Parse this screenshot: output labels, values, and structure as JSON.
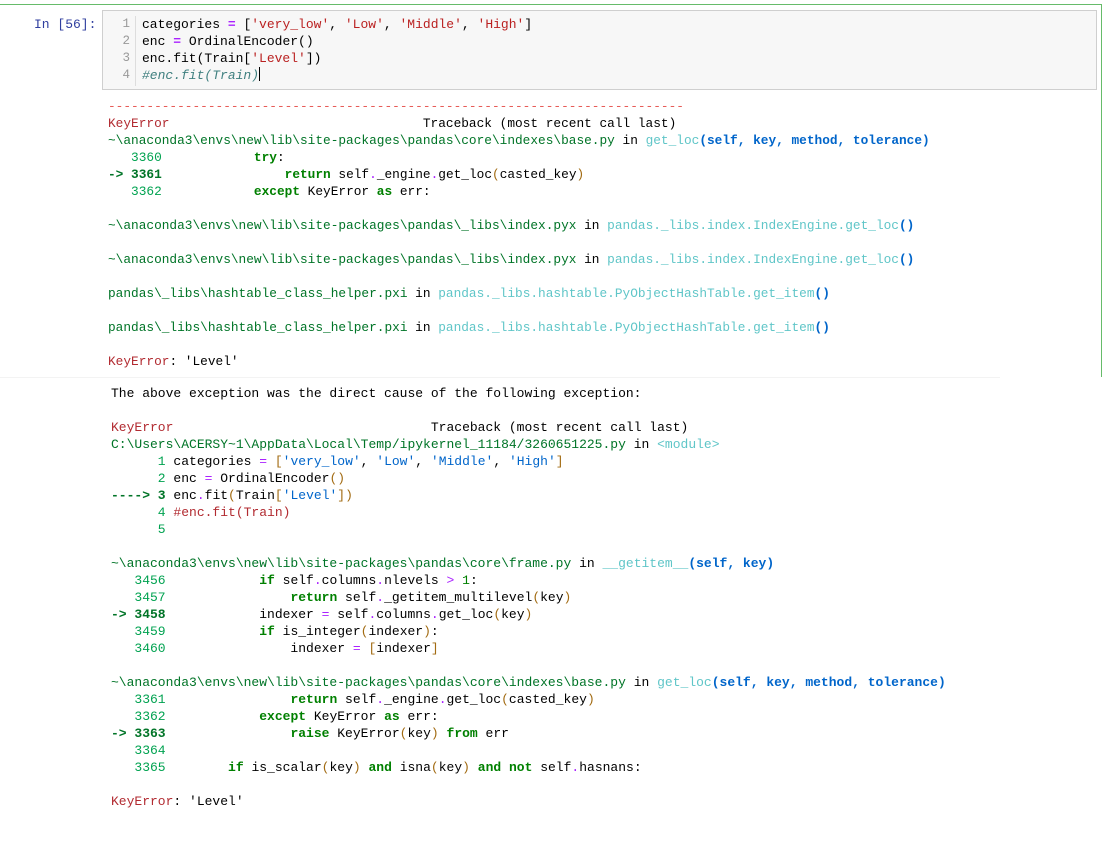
{
  "cell": {
    "prompt": "In [56]:",
    "line_numbers": [
      "1",
      "2",
      "3",
      "4"
    ],
    "code": [
      {
        "parts": [
          {
            "t": "categories ",
            "c": "plain"
          },
          {
            "t": "=",
            "c": "c-op"
          },
          {
            "t": " [",
            "c": "plain"
          },
          {
            "t": "'very_low'",
            "c": "c-str"
          },
          {
            "t": ", ",
            "c": "plain"
          },
          {
            "t": "'Low'",
            "c": "c-str"
          },
          {
            "t": ", ",
            "c": "plain"
          },
          {
            "t": "'Middle'",
            "c": "c-str"
          },
          {
            "t": ", ",
            "c": "plain"
          },
          {
            "t": "'High'",
            "c": "c-str"
          },
          {
            "t": "]",
            "c": "plain"
          }
        ]
      },
      {
        "parts": [
          {
            "t": "enc ",
            "c": "plain"
          },
          {
            "t": "=",
            "c": "c-op"
          },
          {
            "t": " OrdinalEncoder()",
            "c": "plain"
          }
        ]
      },
      {
        "parts": [
          {
            "t": "enc.fit(Train[",
            "c": "plain"
          },
          {
            "t": "'Level'",
            "c": "c-str"
          },
          {
            "t": "])",
            "c": "plain"
          }
        ]
      },
      {
        "parts": [
          {
            "t": "#enc.fit(Train)",
            "c": "code-cm"
          }
        ]
      }
    ]
  },
  "output1": {
    "dashes": "---------------------------------------------------------------------------",
    "error_name": "KeyError",
    "traceback_header": "                                 Traceback (most recent call last)",
    "frames": [
      {
        "path": "~\\anaconda3\\envs\\new\\lib\\site-packages\\pandas\\core\\indexes\\base.py",
        "in": " in ",
        "func": "get_loc",
        "args": "(self, key, method, tolerance)",
        "lines": [
          {
            "num": "   3360",
            "arrow": false,
            "code": [
              {
                "t": "            ",
                "c": "plain"
              },
              {
                "t": "try",
                "c": "kw"
              },
              {
                "t": ":",
                "c": "plain"
              }
            ]
          },
          {
            "num": "-> 3361",
            "arrow": true,
            "code": [
              {
                "t": "                ",
                "c": "plain"
              },
              {
                "t": "return",
                "c": "kw"
              },
              {
                "t": " self",
                "c": "plain"
              },
              {
                "t": ".",
                "c": "op"
              },
              {
                "t": "_engine",
                "c": "plain"
              },
              {
                "t": ".",
                "c": "op"
              },
              {
                "t": "get_loc",
                "c": "plain"
              },
              {
                "t": "(",
                "c": "paren"
              },
              {
                "t": "casted_key",
                "c": "plain"
              },
              {
                "t": ")",
                "c": "paren"
              }
            ]
          },
          {
            "num": "   3362",
            "arrow": false,
            "code": [
              {
                "t": "            ",
                "c": "plain"
              },
              {
                "t": "except",
                "c": "kw"
              },
              {
                "t": " KeyError ",
                "c": "plain"
              },
              {
                "t": "as",
                "c": "kw"
              },
              {
                "t": " err",
                "c": "plain"
              },
              {
                "t": ":",
                "c": "plain"
              }
            ]
          }
        ]
      },
      {
        "path": "~\\anaconda3\\envs\\new\\lib\\site-packages\\pandas\\_libs\\index.pyx",
        "in": " in ",
        "func": "pandas._libs.index.IndexEngine.get_loc",
        "args": "()",
        "lines": []
      },
      {
        "path": "~\\anaconda3\\envs\\new\\lib\\site-packages\\pandas\\_libs\\index.pyx",
        "in": " in ",
        "func": "pandas._libs.index.IndexEngine.get_loc",
        "args": "()",
        "lines": []
      },
      {
        "path": "pandas\\_libs\\hashtable_class_helper.pxi",
        "in": " in ",
        "func": "pandas._libs.hashtable.PyObjectHashTable.get_item",
        "args": "()",
        "lines": []
      },
      {
        "path": "pandas\\_libs\\hashtable_class_helper.pxi",
        "in": " in ",
        "func": "pandas._libs.hashtable.PyObjectHashTable.get_item",
        "args": "()",
        "lines": []
      }
    ],
    "final_error_name": "KeyError",
    "final_error_msg": ": 'Level'"
  },
  "output2": {
    "cause_message": "The above exception was the direct cause of the following exception:",
    "error_name": "KeyError",
    "traceback_header": "                                 Traceback (most recent call last)",
    "frames": [
      {
        "path": "C:\\Users\\ACERSY~1\\AppData\\Local\\Temp/ipykernel_11184/3260651225.py",
        "in": " in ",
        "func": "<module>",
        "args": "",
        "lines": [
          {
            "num": "      1",
            "arrow": false,
            "code": [
              {
                "t": " categories ",
                "c": "plain"
              },
              {
                "t": "=",
                "c": "op"
              },
              {
                "t": " [",
                "c": "paren"
              },
              {
                "t": "'very_low'",
                "c": "str-blue"
              },
              {
                "t": ", ",
                "c": "plain"
              },
              {
                "t": "'Low'",
                "c": "str-blue"
              },
              {
                "t": ", ",
                "c": "plain"
              },
              {
                "t": "'Middle'",
                "c": "str-blue"
              },
              {
                "t": ", ",
                "c": "plain"
              },
              {
                "t": "'High'",
                "c": "str-blue"
              },
              {
                "t": "]",
                "c": "paren"
              }
            ]
          },
          {
            "num": "      2",
            "arrow": false,
            "code": [
              {
                "t": " enc ",
                "c": "plain"
              },
              {
                "t": "=",
                "c": "op"
              },
              {
                "t": " OrdinalEncoder",
                "c": "plain"
              },
              {
                "t": "()",
                "c": "paren"
              }
            ]
          },
          {
            "num": "----> 3",
            "arrow": true,
            "code": [
              {
                "t": " enc",
                "c": "plain"
              },
              {
                "t": ".",
                "c": "op"
              },
              {
                "t": "fit",
                "c": "plain"
              },
              {
                "t": "(",
                "c": "paren"
              },
              {
                "t": "Train",
                "c": "plain"
              },
              {
                "t": "[",
                "c": "paren"
              },
              {
                "t": "'Level'",
                "c": "str-blue"
              },
              {
                "t": "])",
                "c": "paren"
              }
            ]
          },
          {
            "num": "      4",
            "arrow": false,
            "code": [
              {
                "t": " #enc.fit(Train)",
                "c": "cm-red"
              }
            ]
          },
          {
            "num": "      5",
            "arrow": false,
            "code": []
          }
        ]
      },
      {
        "path": "~\\anaconda3\\envs\\new\\lib\\site-packages\\pandas\\core\\frame.py",
        "in": " in ",
        "func": "__getitem__",
        "args": "(self, key)",
        "lines": [
          {
            "num": "   3456",
            "arrow": false,
            "code": [
              {
                "t": "            ",
                "c": "plain"
              },
              {
                "t": "if",
                "c": "kw"
              },
              {
                "t": " self",
                "c": "plain"
              },
              {
                "t": ".",
                "c": "op"
              },
              {
                "t": "columns",
                "c": "plain"
              },
              {
                "t": ".",
                "c": "op"
              },
              {
                "t": "nlevels ",
                "c": "plain"
              },
              {
                "t": ">",
                "c": "gt"
              },
              {
                "t": " ",
                "c": "plain"
              },
              {
                "t": "1",
                "c": "num"
              },
              {
                "t": ":",
                "c": "plain"
              }
            ]
          },
          {
            "num": "   3457",
            "arrow": false,
            "code": [
              {
                "t": "                ",
                "c": "plain"
              },
              {
                "t": "return",
                "c": "kw"
              },
              {
                "t": " self",
                "c": "plain"
              },
              {
                "t": ".",
                "c": "op"
              },
              {
                "t": "_getitem_multilevel",
                "c": "plain"
              },
              {
                "t": "(",
                "c": "paren"
              },
              {
                "t": "key",
                "c": "plain"
              },
              {
                "t": ")",
                "c": "paren"
              }
            ]
          },
          {
            "num": "-> 3458",
            "arrow": true,
            "code": [
              {
                "t": "            indexer ",
                "c": "plain"
              },
              {
                "t": "=",
                "c": "op"
              },
              {
                "t": " self",
                "c": "plain"
              },
              {
                "t": ".",
                "c": "op"
              },
              {
                "t": "columns",
                "c": "plain"
              },
              {
                "t": ".",
                "c": "op"
              },
              {
                "t": "get_loc",
                "c": "plain"
              },
              {
                "t": "(",
                "c": "paren"
              },
              {
                "t": "key",
                "c": "plain"
              },
              {
                "t": ")",
                "c": "paren"
              }
            ]
          },
          {
            "num": "   3459",
            "arrow": false,
            "code": [
              {
                "t": "            ",
                "c": "plain"
              },
              {
                "t": "if",
                "c": "kw"
              },
              {
                "t": " is_integer",
                "c": "plain"
              },
              {
                "t": "(",
                "c": "paren"
              },
              {
                "t": "indexer",
                "c": "plain"
              },
              {
                "t": ")",
                "c": "paren"
              },
              {
                "t": ":",
                "c": "plain"
              }
            ]
          },
          {
            "num": "   3460",
            "arrow": false,
            "code": [
              {
                "t": "                indexer ",
                "c": "plain"
              },
              {
                "t": "=",
                "c": "op"
              },
              {
                "t": " ",
                "c": "plain"
              },
              {
                "t": "[",
                "c": "paren"
              },
              {
                "t": "indexer",
                "c": "plain"
              },
              {
                "t": "]",
                "c": "paren"
              }
            ]
          }
        ]
      },
      {
        "path": "~\\anaconda3\\envs\\new\\lib\\site-packages\\pandas\\core\\indexes\\base.py",
        "in": " in ",
        "func": "get_loc",
        "args": "(self, key, method, tolerance)",
        "lines": [
          {
            "num": "   3361",
            "arrow": false,
            "code": [
              {
                "t": "                ",
                "c": "plain"
              },
              {
                "t": "return",
                "c": "kw"
              },
              {
                "t": " self",
                "c": "plain"
              },
              {
                "t": ".",
                "c": "op"
              },
              {
                "t": "_engine",
                "c": "plain"
              },
              {
                "t": ".",
                "c": "op"
              },
              {
                "t": "get_loc",
                "c": "plain"
              },
              {
                "t": "(",
                "c": "paren"
              },
              {
                "t": "casted_key",
                "c": "plain"
              },
              {
                "t": ")",
                "c": "paren"
              }
            ]
          },
          {
            "num": "   3362",
            "arrow": false,
            "code": [
              {
                "t": "            ",
                "c": "plain"
              },
              {
                "t": "except",
                "c": "kw"
              },
              {
                "t": " KeyError ",
                "c": "plain"
              },
              {
                "t": "as",
                "c": "kw"
              },
              {
                "t": " err",
                "c": "plain"
              },
              {
                "t": ":",
                "c": "plain"
              }
            ]
          },
          {
            "num": "-> 3363",
            "arrow": true,
            "code": [
              {
                "t": "                ",
                "c": "plain"
              },
              {
                "t": "raise",
                "c": "kw"
              },
              {
                "t": " KeyError",
                "c": "plain"
              },
              {
                "t": "(",
                "c": "paren"
              },
              {
                "t": "key",
                "c": "plain"
              },
              {
                "t": ")",
                "c": "paren"
              },
              {
                "t": " ",
                "c": "plain"
              },
              {
                "t": "from",
                "c": "kw"
              },
              {
                "t": " err",
                "c": "plain"
              }
            ]
          },
          {
            "num": "   3364",
            "arrow": false,
            "code": []
          },
          {
            "num": "   3365",
            "arrow": false,
            "code": [
              {
                "t": "        ",
                "c": "plain"
              },
              {
                "t": "if",
                "c": "kw"
              },
              {
                "t": " is_scalar",
                "c": "plain"
              },
              {
                "t": "(",
                "c": "paren"
              },
              {
                "t": "key",
                "c": "plain"
              },
              {
                "t": ")",
                "c": "paren"
              },
              {
                "t": " ",
                "c": "plain"
              },
              {
                "t": "and",
                "c": "kw"
              },
              {
                "t": " isna",
                "c": "plain"
              },
              {
                "t": "(",
                "c": "paren"
              },
              {
                "t": "key",
                "c": "plain"
              },
              {
                "t": ")",
                "c": "paren"
              },
              {
                "t": " ",
                "c": "plain"
              },
              {
                "t": "and",
                "c": "kw"
              },
              {
                "t": " ",
                "c": "plain"
              },
              {
                "t": "not",
                "c": "kw"
              },
              {
                "t": " self",
                "c": "plain"
              },
              {
                "t": ".",
                "c": "op"
              },
              {
                "t": "hasnans",
                "c": "plain"
              },
              {
                "t": ":",
                "c": "plain"
              }
            ]
          }
        ]
      }
    ],
    "final_error_name": "KeyError",
    "final_error_msg": ": 'Level'"
  },
  "colors": {
    "cell_border": "#66bb6a",
    "prompt": "#303f9f",
    "error_red": "#b22b31",
    "path_green": "#007427",
    "func_cyan": "#60c6c8",
    "args_blue": "#0065ca"
  }
}
